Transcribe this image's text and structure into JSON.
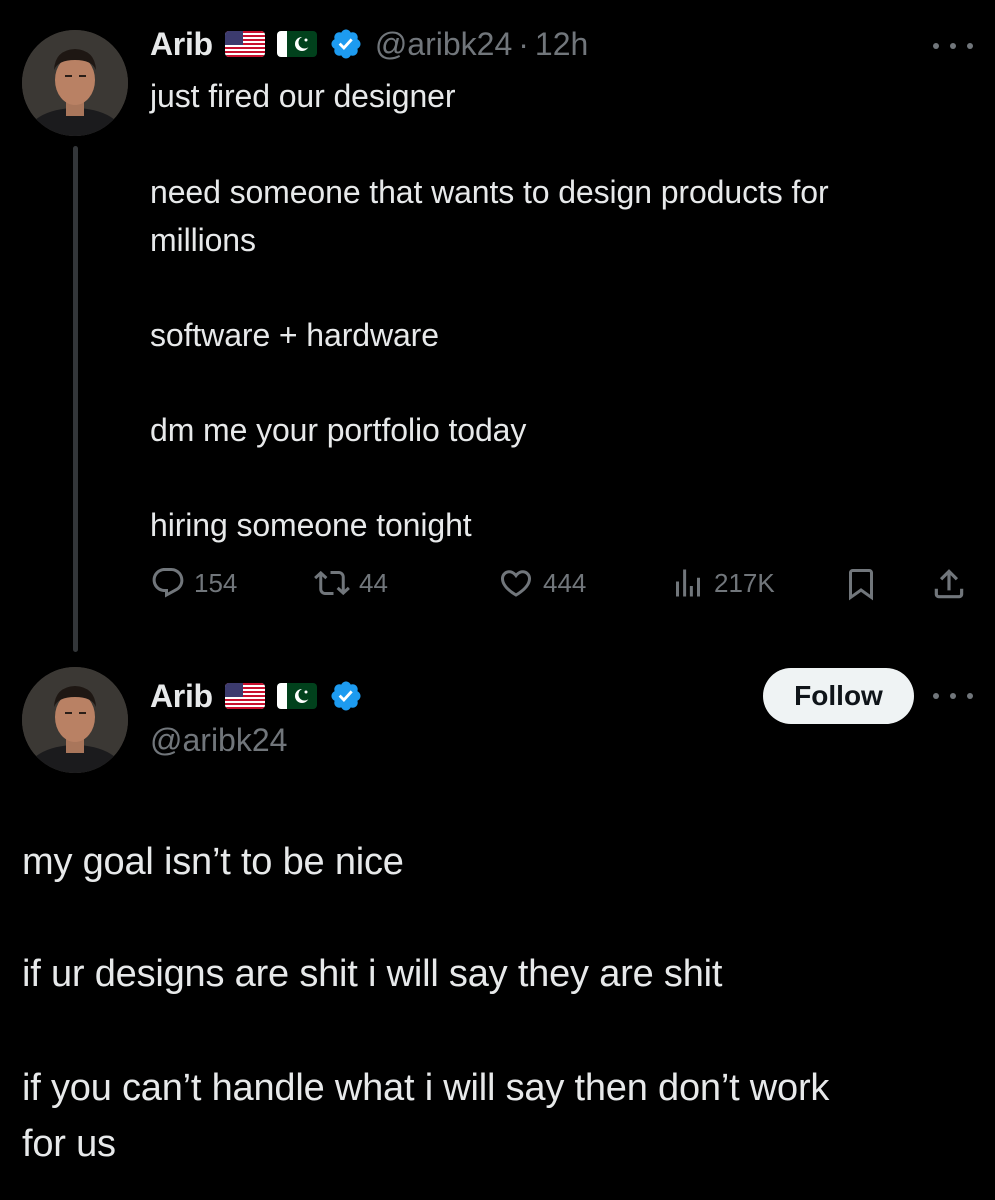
{
  "tweet": {
    "author_name": "Arib",
    "flags": [
      "us-flag",
      "pk-flag"
    ],
    "verified_icon": "verified-badge-icon",
    "handle": "@aribk24",
    "separator": "·",
    "timestamp": "12h",
    "more_icon": "more-icon",
    "lines": [
      "just fired our designer",
      "need someone that wants to design products for",
      "millions",
      "software + hardware",
      "dm me your portfolio today",
      "hiring someone tonight"
    ],
    "actions": {
      "replies": "154",
      "reposts": "44",
      "likes": "444",
      "views": "217K"
    }
  },
  "profile": {
    "author_name": "Arib",
    "handle": "@aribk24",
    "follow_label": "Follow",
    "lines": [
      "my goal isn’t to be nice",
      "if ur designs are shit i will say they are shit",
      "if you can’t handle what i will say then don’t work",
      "for us"
    ]
  },
  "colors": {
    "background": "#000000",
    "text": "#e7e9ea",
    "muted": "#71767b",
    "verified": "#1d9bf0",
    "thread_line": "#333639"
  }
}
